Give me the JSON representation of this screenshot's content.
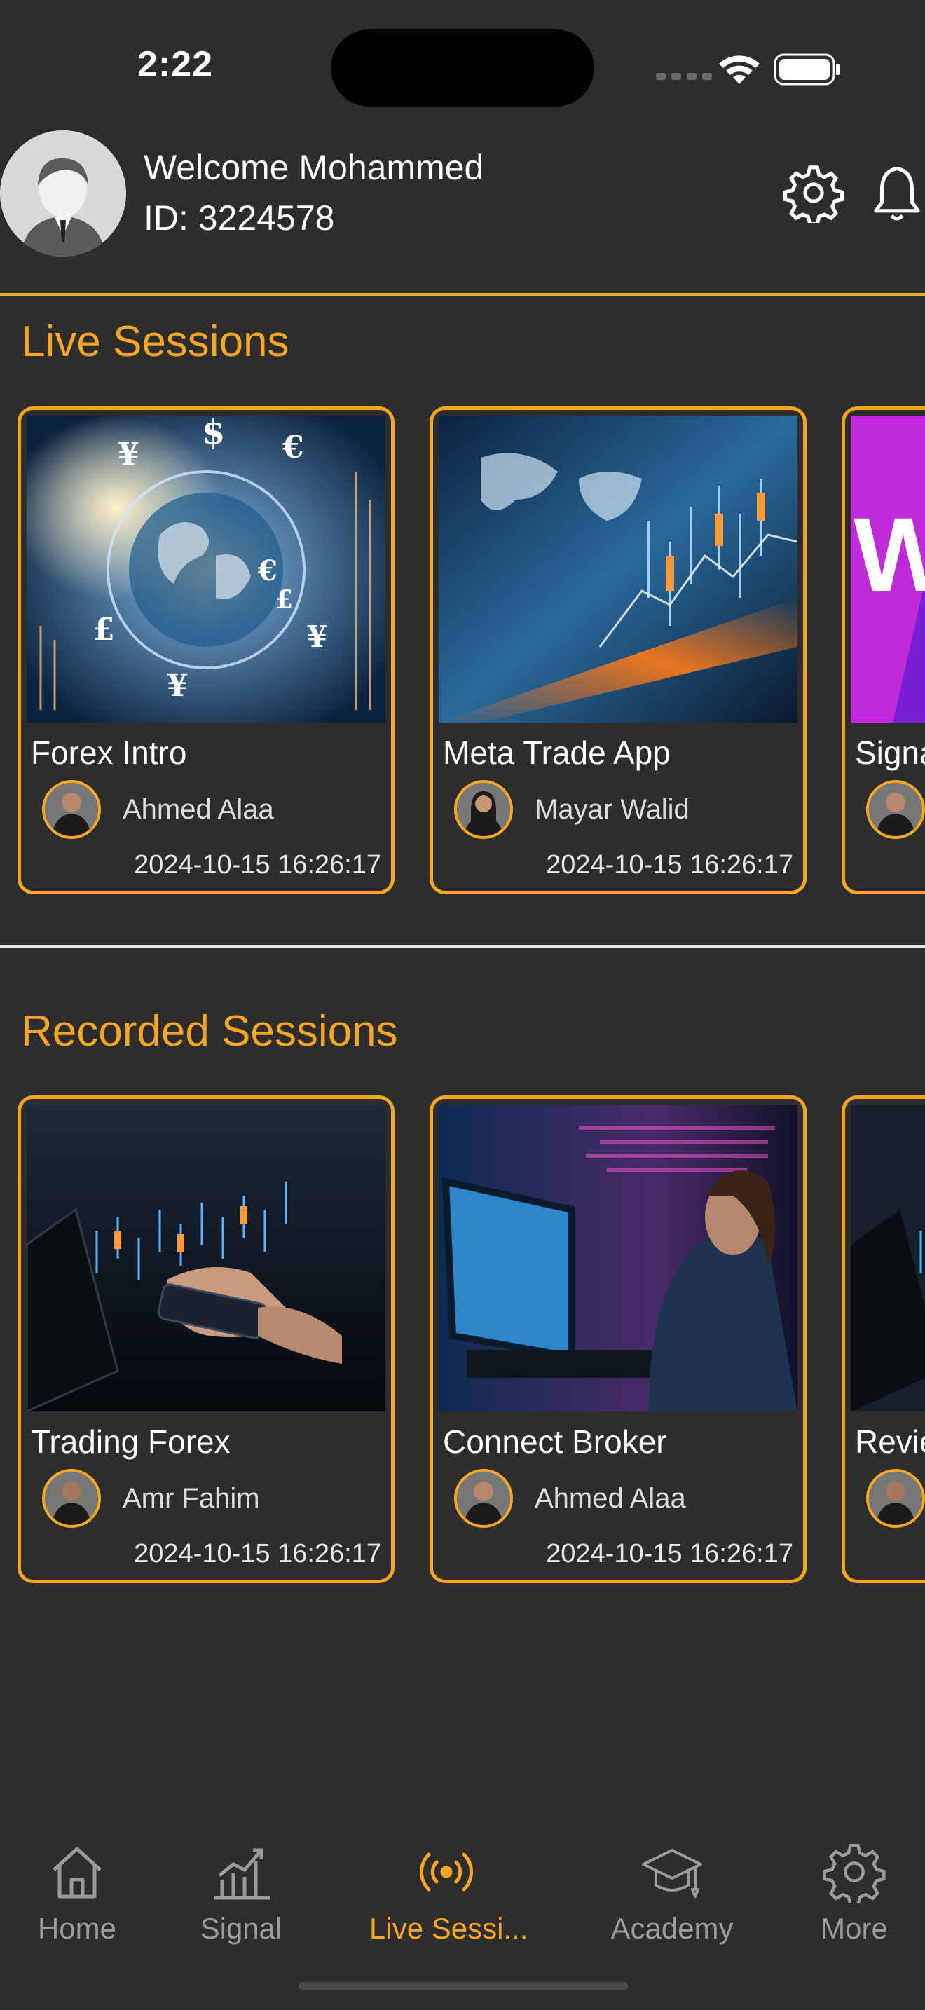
{
  "status_bar": {
    "time": "2:22"
  },
  "header": {
    "welcome": "Welcome Mohammed",
    "user_id": "ID: 3224578"
  },
  "live_sessions": {
    "title": "Live Sessions",
    "cards": [
      {
        "title": "Forex Intro",
        "host": "Ahmed Alaa",
        "date": "2024-10-15 16:26:17"
      },
      {
        "title": "Meta Trade App",
        "host": "Mayar Walid",
        "date": "2024-10-15 16:26:17"
      },
      {
        "title": "Signa",
        "host": "",
        "date": ""
      }
    ]
  },
  "recorded_sessions": {
    "title": "Recorded Sessions",
    "cards": [
      {
        "title": "Trading Forex",
        "host": "Amr Fahim",
        "date": "2024-10-15 16:26:17"
      },
      {
        "title": "Connect Broker",
        "host": "Ahmed Alaa",
        "date": "2024-10-15 16:26:17"
      },
      {
        "title": "Revie",
        "host": "",
        "date": ""
      }
    ]
  },
  "tabbar": {
    "tabs": [
      {
        "label": "Home",
        "icon": "home-icon"
      },
      {
        "label": "Signal",
        "icon": "chart-icon"
      },
      {
        "label": "Live Sessi...",
        "icon": "broadcast-icon",
        "active": true
      },
      {
        "label": "Academy",
        "icon": "graduation-cap-icon"
      },
      {
        "label": "More",
        "icon": "gear-icon"
      }
    ]
  },
  "colors": {
    "accent": "#f5a623",
    "background": "#2d2d2d",
    "inactive": "#9b9b9b"
  }
}
